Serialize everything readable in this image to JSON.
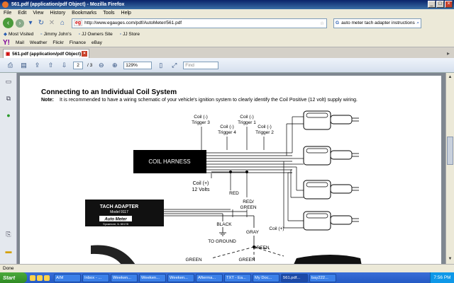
{
  "window": {
    "title": "561.pdf (application/pdf Object) - Mozilla Firefox",
    "buttons": [
      "_",
      "□",
      "×"
    ]
  },
  "menu": [
    "File",
    "Edit",
    "View",
    "History",
    "Bookmarks",
    "Tools",
    "Help"
  ],
  "nav": {
    "url": "http://www.egauges.com/pdf/AutoMeter/561.pdf",
    "url_favicon": "eg",
    "search_value": "auto meter tach adapter instructions",
    "search_engine": "G"
  },
  "bookmarks": [
    "Most Visited",
    "Jimmy John's",
    "JJ Owners Site",
    "JJ Store"
  ],
  "yahoo_bar": {
    "logo": "Y!",
    "items": [
      "Mail",
      "Weather",
      "Flickr",
      "Finance",
      "eBay"
    ]
  },
  "tab": {
    "label": "561.pdf (application/pdf Object)"
  },
  "pdf_toolbar": {
    "page_current": "2",
    "page_total": "/ 3",
    "zoom": "129%",
    "find_placeholder": "Find"
  },
  "page": {
    "heading": "Connecting to an Individual Coil System",
    "note_label": "Note:",
    "note_text": "It is recommended to have a wiring schematic of your vehicle's ignition system to clearly identify the Coil Positive (12 volt) supply wiring."
  },
  "diagram": {
    "coil_harness": "COIL HARNESS",
    "trigger3_a": "Coil (-)",
    "trigger3_b": "Trigger 3",
    "trigger4_a": "Coil (-)",
    "trigger4_b": "Trigger 4",
    "trigger1_a": "Coil (-)",
    "trigger1_b": "Trigger 1",
    "trigger2_a": "Coil (-)",
    "trigger2_b": "Trigger 2",
    "coil_pos_a": "Coil (+)",
    "coil_pos_b": "12 Volts",
    "red": "RED",
    "red_green_a": "RED/",
    "red_green_b": "GREEN",
    "black": "BLACK",
    "to_ground": "TO GROUND",
    "gray": "GRAY",
    "coil_plus_right": "Coil (+)",
    "green1": "GREEN",
    "green2": "GREEN",
    "green3": "GREEN",
    "tach_title": "TACH ADAPTER",
    "tach_model": "Model 9117",
    "tach_brand": "Auto Meter",
    "tach_addr": "Sycamore, IL 60178"
  },
  "status": "Done",
  "taskbar": {
    "start": "Start",
    "tasks": [
      "AIM",
      "Inbox - ...",
      "Weeken...",
      "Weeken...",
      "Weeken...",
      "Afterma...",
      "TXT - Ea...",
      "My Doc...",
      "561.pdf...",
      "bay222..."
    ],
    "clock": "7:56 PM"
  }
}
